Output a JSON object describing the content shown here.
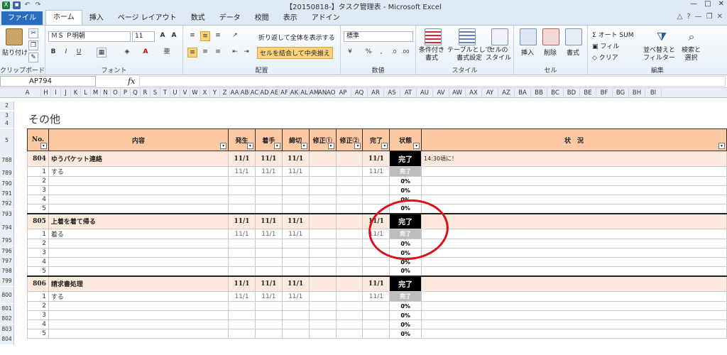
{
  "window": {
    "title": "【20150818-】タスク管理表 - Microsoft Excel",
    "controls": [
      "—",
      "□",
      "✕"
    ]
  },
  "tabs": {
    "file": "ファイル",
    "items": [
      "ホーム",
      "挿入",
      "ページ レイアウト",
      "数式",
      "データ",
      "校閲",
      "表示",
      "アドイン"
    ]
  },
  "ribbon": {
    "clipboard": {
      "paste": "貼り付け",
      "label": "クリップボード"
    },
    "font": {
      "name": "ＭＳ Ｐ明朝",
      "size": "11",
      "label": "フォント"
    },
    "alignment": {
      "wrap": "折り返して全体を表示する",
      "merge": "セルを結合して中央揃え",
      "label": "配置"
    },
    "number": {
      "format": "標準",
      "label": "数値"
    },
    "styles": {
      "cond": "条件付き\n書式",
      "table": "テーブルとして\n書式設定",
      "cell": "セルの\nスタイル",
      "label": "スタイル"
    },
    "cells": {
      "insert": "挿入",
      "delete": "削除",
      "format": "書式",
      "label": "セル"
    },
    "editing": {
      "autosum": "オート SUM",
      "fill": "フィル",
      "clear": "クリア",
      "sort": "並べ替えと\nフィルター",
      "find": "検索と\n選択",
      "label": "編集"
    }
  },
  "formula_bar": {
    "name_box": "AP794",
    "fx": "fx",
    "content": ""
  },
  "columns": [
    "A",
    "H",
    "I",
    "J",
    "K",
    "L",
    "M",
    "N",
    "O",
    "P",
    "Q",
    "R",
    "S",
    "T",
    "U",
    "V",
    "W",
    "X",
    "Y",
    "Z",
    "AA",
    "AB",
    "AC",
    "AD",
    "AE",
    "AF",
    "AK",
    "AL",
    "AM",
    "AN",
    "AO",
    "AP",
    "AQ",
    "AR",
    "AS",
    "AT",
    "AU",
    "AV",
    "AW",
    "AX",
    "AY",
    "AZ",
    "BA",
    "BB",
    "BC",
    "BD",
    "BE",
    "BF",
    "BG",
    "BH",
    "BI"
  ],
  "row_numbers": [
    "2",
    "3",
    "4",
    "5",
    "788",
    "789",
    "790",
    "791",
    "792",
    "793",
    "794",
    "795",
    "796",
    "797",
    "798",
    "799",
    "800",
    "801",
    "802",
    "803",
    "804"
  ],
  "sheet": {
    "section_title": "その他",
    "headers": [
      "No.",
      "内容",
      "発生",
      "着手",
      "締切",
      "修正①",
      "修正②",
      "完了",
      "状態",
      "状　況"
    ],
    "tasks": [
      {
        "no": "804",
        "title": "ゆうパケット連絡",
        "occur": "11/1",
        "start": "11/1",
        "due": "11/1",
        "fix1": "",
        "fix2": "",
        "done": "11/1",
        "status": "完了",
        "note": "14:30頃に！",
        "subs": [
          {
            "no": "1",
            "text": "する",
            "occur": "11/1",
            "start": "11/1",
            "due": "11/1",
            "done": "11/1",
            "status": "完了"
          },
          {
            "no": "2",
            "text": "",
            "status": "0%"
          },
          {
            "no": "3",
            "text": "",
            "status": "0%"
          },
          {
            "no": "4",
            "text": "",
            "status": "0%"
          },
          {
            "no": "5",
            "text": "",
            "status": "0%"
          }
        ]
      },
      {
        "no": "805",
        "title": "上着を着て帰る",
        "occur": "11/1",
        "start": "11/1",
        "due": "11/1",
        "fix1": "",
        "fix2": "",
        "done": "11/1",
        "status": "完了",
        "note": "",
        "subs": [
          {
            "no": "1",
            "text": "着る",
            "occur": "11/1",
            "start": "11/1",
            "due": "11/1",
            "done": "11/1",
            "status": "完了"
          },
          {
            "no": "2",
            "text": "",
            "status": "0%"
          },
          {
            "no": "3",
            "text": "",
            "status": "0%"
          },
          {
            "no": "4",
            "text": "",
            "status": "0%"
          },
          {
            "no": "5",
            "text": "",
            "status": "0%"
          }
        ]
      },
      {
        "no": "806",
        "title": "請求書処理",
        "occur": "11/1",
        "start": "11/1",
        "due": "11/1",
        "fix1": "",
        "fix2": "",
        "done": "11/1",
        "status": "完了",
        "note": "",
        "subs": [
          {
            "no": "1",
            "text": "する",
            "occur": "11/1",
            "start": "11/1",
            "due": "11/1",
            "done": "11/1",
            "status": "完了"
          },
          {
            "no": "2",
            "text": "",
            "status": "0%"
          },
          {
            "no": "3",
            "text": "",
            "status": "0%"
          },
          {
            "no": "4",
            "text": "",
            "status": "0%"
          },
          {
            "no": "5",
            "text": "",
            "status": "0%"
          }
        ]
      }
    ]
  },
  "colors": {
    "header_fill": "#fcc9a3",
    "main_row_fill": "#fde8dc",
    "done_fill": "#000000",
    "annotation": "#d7111c"
  }
}
